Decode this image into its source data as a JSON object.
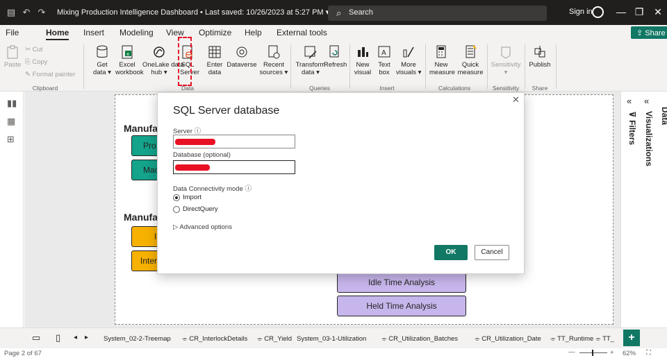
{
  "titlebar": {
    "title": "Mixing Production Intelligence Dashboard • Last saved: 10/26/2023 at 5:27 PM ▾",
    "search_placeholder": "Search",
    "sign_in": "Sign in"
  },
  "menu": {
    "tabs": [
      "File",
      "Home",
      "Insert",
      "Modeling",
      "View",
      "Optimize",
      "Help",
      "External tools"
    ],
    "share": "Share"
  },
  "ribbon": {
    "clipboard": {
      "paste": "Paste",
      "cut": "Cut",
      "copy": "Copy",
      "format_painter": "Format painter",
      "label": "Clipboard"
    },
    "data": {
      "get_data": "Get\ndata ▾",
      "excel": "Excel\nworkbook",
      "onelake": "OneLake data\nhub ▾",
      "sql": "SQL\nServer",
      "enter": "Enter\ndata",
      "dataverse": "Dataverse",
      "recent": "Recent\nsources ▾",
      "label": "Data"
    },
    "queries": {
      "transform": "Transform\ndata ▾",
      "refresh": "Refresh",
      "label": "Queries"
    },
    "insert": {
      "new_visual": "New\nvisual",
      "text_box": "Text\nbox",
      "more_visuals": "More\nvisuals ▾",
      "label": "Insert"
    },
    "calculations": {
      "new_measure": "New\nmeasure",
      "quick_measure": "Quick\nmeasure",
      "label": "Calculations"
    },
    "sensitivity": {
      "sensitivity": "Sensitivity\n▾",
      "label": "Sensitivity"
    },
    "share": {
      "publish": "Publish",
      "label": "Share"
    }
  },
  "canvas": {
    "section1": "Manufa",
    "section2": "Manufa",
    "chips": {
      "teal1": "Pro",
      "teal2": "Mac",
      "amber1": "I",
      "amber2": "Inter",
      "idle": "Idle Time Analysis",
      "held": "Held Time Analysis"
    }
  },
  "panes": {
    "filters": "Filters",
    "visualizations": "Visualizations",
    "data": "Data"
  },
  "dialog": {
    "title": "SQL Server database",
    "server_label": "Server ⓘ",
    "database_label": "Database (optional)",
    "mode_label": "Data Connectivity mode ⓘ",
    "import": "Import",
    "directquery": "DirectQuery",
    "advanced": "▷ Advanced options",
    "ok": "OK",
    "cancel": "Cancel",
    "selected_mode": "Import"
  },
  "page_tabs": [
    "System_02-2-Treemap",
    "CR_InterlockDetails",
    "CR_Yield",
    "System_03-1-Utilization",
    "CR_Utilization_Batches",
    "CR_Utilization_Date",
    "TT_Runtime",
    "TT_"
  ],
  "status": {
    "page": "Page 2 of 67",
    "zoom": "62%"
  },
  "colors": {
    "accent": "#117865",
    "teal": "#14a38b",
    "amber": "#f7b100",
    "lavender": "#c7b6ec",
    "highlight": "#e81123"
  }
}
